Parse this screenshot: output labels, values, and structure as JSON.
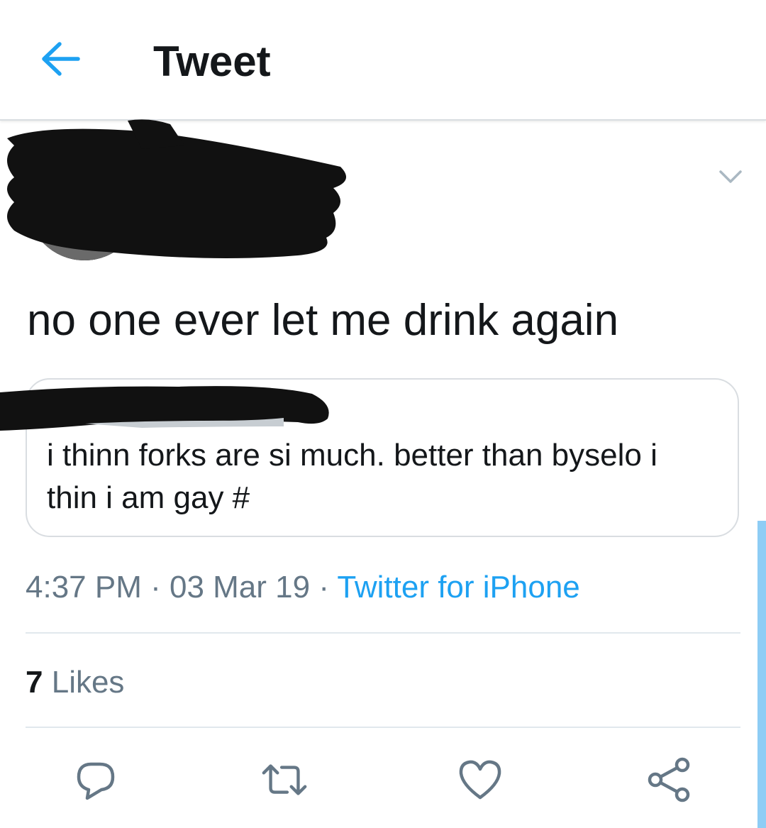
{
  "header": {
    "title": "Tweet"
  },
  "icons": {
    "back": "arrow-left-icon",
    "caret": "chevron-down-icon",
    "reply": "reply-icon",
    "retweet": "retweet-icon",
    "like": "heart-icon",
    "share": "share-icon"
  },
  "tweet": {
    "text": "no one ever let me drink again",
    "quote": {
      "text": "i thinn forks are si much. better than byselo i thin i am gay #"
    },
    "time": "4:37 PM",
    "separator": " · ",
    "date": "03 Mar 19",
    "source": "Twitter for iPhone",
    "likes_count": "7",
    "likes_label": "Likes"
  },
  "colors": {
    "accent": "#1da1f2",
    "text_primary": "#14171a",
    "text_secondary": "#657786",
    "divider": "#e1e8ed",
    "icon": "#657786",
    "redaction": "#111111"
  }
}
